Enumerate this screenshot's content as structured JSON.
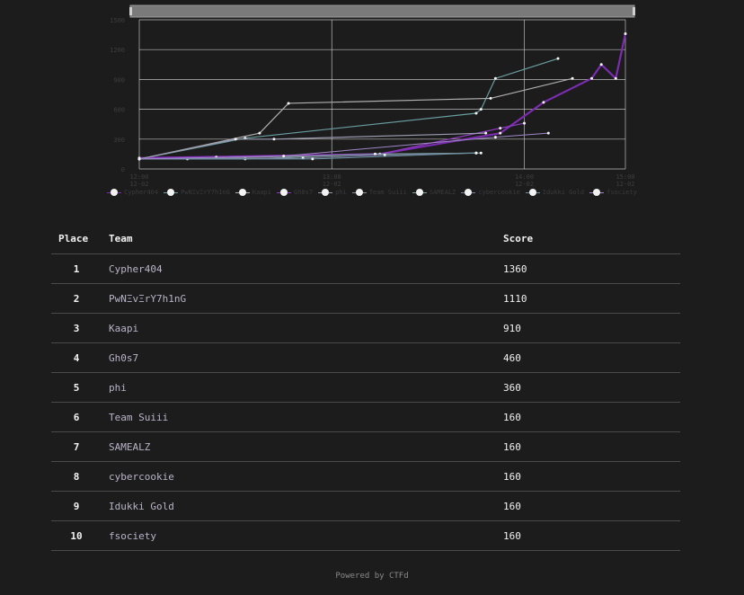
{
  "chart_data": {
    "type": "line",
    "title": "",
    "xlabel": "",
    "ylabel": "",
    "ylim": [
      0,
      1500
    ],
    "y_ticks": [
      "0",
      "300",
      "600",
      "900",
      "1200",
      "1500"
    ],
    "x_ticks": [
      {
        "value": 0,
        "line1": "12:00",
        "line2": "12-02"
      },
      {
        "value": 4,
        "line1": "13:00",
        "line2": "12-02"
      },
      {
        "value": 8,
        "line1": "14:00",
        "line2": "12-02"
      },
      {
        "value": 10.1,
        "line1": "15:00",
        "line2": "12-02"
      }
    ],
    "xlim": [
      0,
      10.1
    ],
    "grid": true,
    "legend_placement": "bottom",
    "series": [
      {
        "name": "Cypher404",
        "color": "#7b2cb0",
        "width": 2.2,
        "x": [
          0,
          5.0,
          7.5,
          8.4,
          9.4,
          9.6,
          9.9,
          10.1
        ],
        "y": [
          110,
          150,
          360,
          670,
          910,
          1050,
          910,
          1360
        ]
      },
      {
        "name": "PwNΞvΞrY7h1nG",
        "color": "#6a9da0",
        "width": 1.2,
        "x": [
          0,
          2.2,
          7.0,
          7.1,
          7.4,
          8.7
        ],
        "y": [
          100,
          310,
          560,
          600,
          910,
          1110
        ]
      },
      {
        "name": "Kaapi",
        "color": "#b0b0b0",
        "width": 1.2,
        "x": [
          0,
          2.5,
          3.1,
          7.3,
          9.0
        ],
        "y": [
          100,
          360,
          660,
          710,
          910
        ]
      },
      {
        "name": "Gh0s7",
        "color": "#8e3ac0",
        "width": 1.2,
        "x": [
          0,
          1.6,
          5.0,
          7.5,
          8.0
        ],
        "y": [
          110,
          120,
          150,
          410,
          460
        ]
      },
      {
        "name": "phi",
        "color": "#9a9ab0",
        "width": 1.2,
        "x": [
          0,
          2.0,
          2.8,
          7.2
        ],
        "y": [
          100,
          300,
          300,
          360
        ]
      },
      {
        "name": "Team Suiii",
        "color": "#8a8a9a",
        "width": 1.0,
        "x": [
          0,
          1.0,
          4.9,
          7.0
        ],
        "y": [
          100,
          100,
          150,
          160
        ]
      },
      {
        "name": "SAMEALZ",
        "color": "#7aa0a0",
        "width": 1.0,
        "x": [
          0,
          2.2,
          4.9,
          7.1
        ],
        "y": [
          100,
          100,
          150,
          160
        ]
      },
      {
        "name": "cybercookie",
        "color": "#7a80a0",
        "width": 1.0,
        "x": [
          0,
          3.4,
          5.1,
          7.0
        ],
        "y": [
          100,
          110,
          140,
          160
        ]
      },
      {
        "name": "Idukki Gold",
        "color": "#6a90a0",
        "width": 1.0,
        "x": [
          0,
          3.6,
          7.0
        ],
        "y": [
          100,
          100,
          160
        ]
      },
      {
        "name": "fsociety",
        "color": "#a088c8",
        "width": 1.0,
        "x": [
          0,
          3.0,
          7.4,
          8.5
        ],
        "y": [
          100,
          130,
          320,
          360
        ]
      }
    ]
  },
  "table": {
    "headers": {
      "place": "Place",
      "team": "Team",
      "score": "Score"
    },
    "rows": [
      {
        "place": "1",
        "team": "Cypher404",
        "score": "1360"
      },
      {
        "place": "2",
        "team": "PwNΞvΞrY7h1nG",
        "score": "1110"
      },
      {
        "place": "3",
        "team": "Kaapi",
        "score": "910"
      },
      {
        "place": "4",
        "team": "Gh0s7",
        "score": "460"
      },
      {
        "place": "5",
        "team": "phi",
        "score": "360"
      },
      {
        "place": "6",
        "team": "Team Suiii",
        "score": "160"
      },
      {
        "place": "7",
        "team": "SAMEALZ",
        "score": "160"
      },
      {
        "place": "8",
        "team": "cybercookie",
        "score": "160"
      },
      {
        "place": "9",
        "team": "Idukki Gold",
        "score": "160"
      },
      {
        "place": "10",
        "team": "fsociety",
        "score": "160"
      }
    ]
  },
  "footer": {
    "text": "Powered by CTFd"
  }
}
